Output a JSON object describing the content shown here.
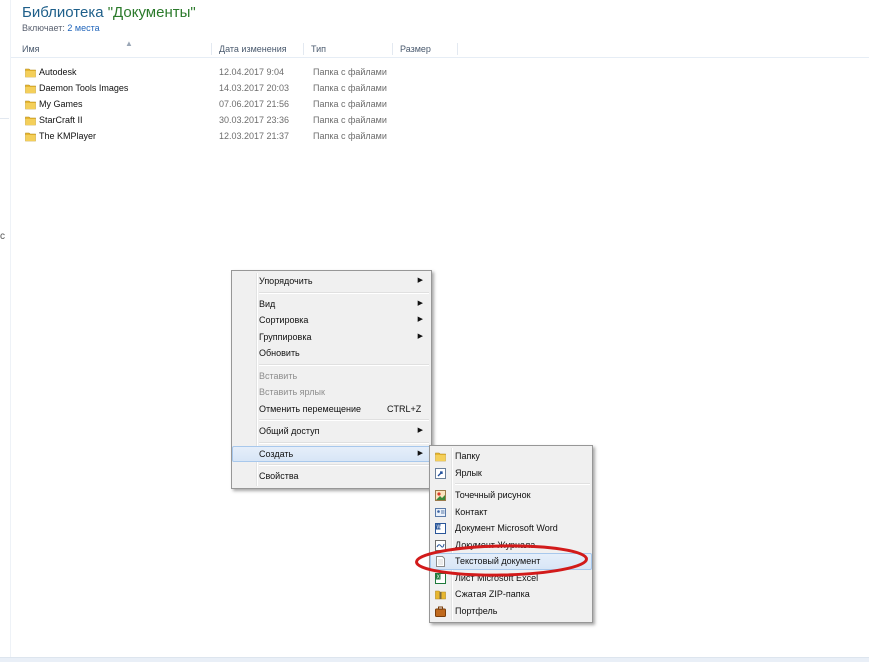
{
  "library": {
    "title_prefix": "Библиотека ",
    "title_name": "\"Документы\"",
    "includes_label": "Включает: ",
    "includes_link": "2 места"
  },
  "columns": {
    "name": "Имя",
    "date": "Дата изменения",
    "type": "Тип",
    "size": "Размер"
  },
  "files": [
    {
      "name": "Autodesk",
      "date": "12.04.2017 9:04",
      "type": "Папка с файлами",
      "icon": "folder-icon"
    },
    {
      "name": "Daemon Tools Images",
      "date": "14.03.2017 20:03",
      "type": "Папка с файлами",
      "icon": "folder-icon"
    },
    {
      "name": "My Games",
      "date": "07.06.2017 21:56",
      "type": "Папка с файлами",
      "icon": "folder-icon"
    },
    {
      "name": "StarCraft II",
      "date": "30.03.2017 23:36",
      "type": "Папка с файлами",
      "icon": "folder-icon"
    },
    {
      "name": "The KMPlayer",
      "date": "12.03.2017 21:37",
      "type": "Папка с файлами",
      "icon": "folder-icon"
    }
  ],
  "left_strip_glyph": "с",
  "context_menu": {
    "arrange": "Упорядочить",
    "view": "Вид",
    "sort": "Сортировка",
    "group": "Группировка",
    "refresh": "Обновить",
    "paste": "Вставить",
    "paste_shortcut": "Вставить ярлык",
    "undo_move": "Отменить перемещение",
    "undo_move_key": "CTRL+Z",
    "share": "Общий доступ",
    "new": "Создать",
    "properties": "Свойства",
    "submenu_arrow": "▶"
  },
  "new_submenu": {
    "folder": "Папку",
    "shortcut": "Ярлык",
    "bitmap": "Точечный рисунок",
    "contact": "Контакт",
    "word": "Документ Microsoft Word",
    "journal": "Документ Журнала",
    "text": "Текстовый документ",
    "excel": "Лист Microsoft Excel",
    "zip": "Сжатая ZIP-папка",
    "briefcase": "Портфель"
  },
  "colors": {
    "annotation_ellipse": "#d21a1a",
    "folder_yellow": "#e8b730",
    "menu_highlight": "#d7e5f6",
    "title_green": "#2b7a2b"
  }
}
